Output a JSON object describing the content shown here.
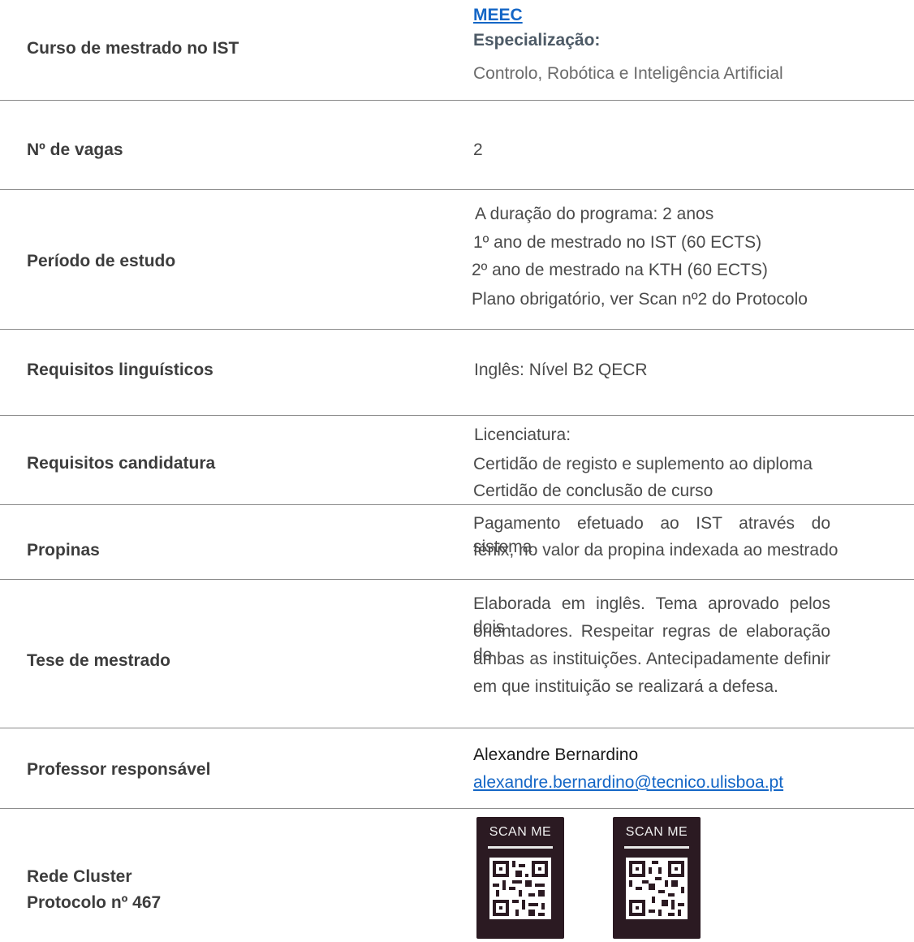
{
  "rows": {
    "curso": {
      "label": "Curso de mestrado no IST",
      "link": "MEEC",
      "spec_label": "Especialização:",
      "spec_value": "Controlo, Robótica e Inteligência Artificial"
    },
    "vagas": {
      "label": "Nº de vagas",
      "value": "2"
    },
    "periodo": {
      "label": "Período de estudo",
      "lines": [
        "A duração do programa:  2 anos",
        "1º ano de mestrado no IST (60 ECTS)",
        "2º ano de mestrado na KTH (60 ECTS)",
        "Plano obrigatório, ver Scan nº2 do Protocolo"
      ]
    },
    "linguisticos": {
      "label": "Requisitos linguísticos",
      "value": "Inglês:  Nível B2 QECR"
    },
    "candidatura": {
      "label": "Requisitos candidatura",
      "lines": [
        "Licenciatura:",
        "Certidão de registo e suplemento ao diploma",
        "Certidão de conclusão de curso"
      ]
    },
    "propinas": {
      "label": "Propinas",
      "lines": [
        "Pagamento efetuado ao IST através do sistema",
        "fénix, no valor da propina indexada ao mestrado"
      ]
    },
    "tese": {
      "label": "Tese de mestrado",
      "lines": [
        "Elaborada em inglês. Tema aprovado pelos dois",
        "orientadores. Respeitar regras de elaboração de",
        "ambas as instituições. Antecipadamente definir",
        "em que instituição se realizará a defesa."
      ]
    },
    "professor": {
      "label": "Professor responsável",
      "name": "Alexandre Bernardino",
      "email": "alexandre.bernardino@tecnico.ulisboa.pt"
    },
    "rede": {
      "label_line1": "Rede Cluster",
      "label_line2": "Protocolo nº 467",
      "qr1": "SCAN ME",
      "qr2": "SCAN ME"
    }
  },
  "colors": {
    "link": "#1466c6",
    "rule": "#8a8a8a",
    "qr_bg": "#2b1a22"
  }
}
